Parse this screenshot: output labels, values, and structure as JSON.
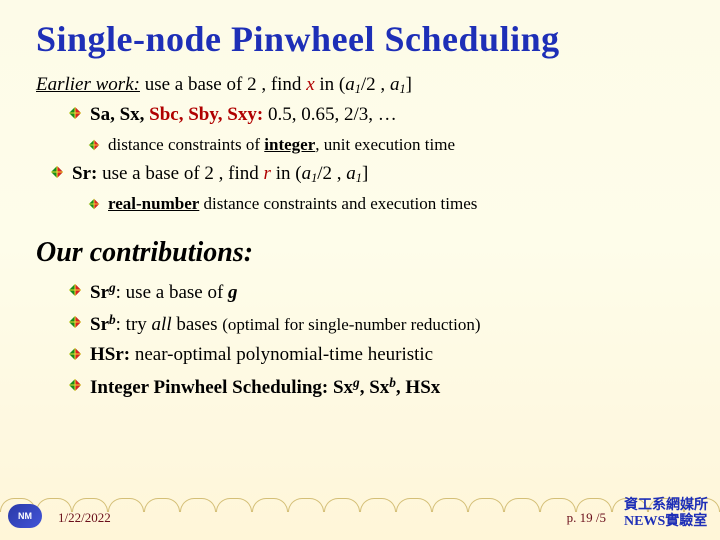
{
  "title": "Single-node Pinwheel Scheduling",
  "earlier": {
    "label": "Earlier work:",
    "rest_a": " use a base of 2 , find ",
    "x": "x",
    "rest_b": " in (",
    "a1": "a",
    "sub1": "1",
    "rest_c": "/2 , ",
    "a2": "a",
    "sub2": "1",
    "close": "]"
  },
  "line_sa": {
    "lead": "Sa, Sx, ",
    "red": "Sbc, Sby, Sxy:",
    "vals": " 0.5, 0.65, 2/3, …"
  },
  "line_dist_int": {
    "a": "distance constraints of ",
    "b": "integer",
    "c": ", unit execution time"
  },
  "line_sr": {
    "lead": "Sr:",
    "a": " use a base of 2 , find ",
    "r": "r",
    "b": " in (",
    "a1": "a",
    "s1": "1",
    "c": "/2 , ",
    "a2": "a",
    "s2": "1",
    "close": "]"
  },
  "line_real": {
    "a": "real-number",
    "b": " distance constraints and execution times"
  },
  "heading2": "Our contributions:",
  "contribs": {
    "c0": {
      "h": "Sr",
      "sup": "g",
      "a": ": use a base of ",
      "g": "g"
    },
    "c1": {
      "h": "Sr",
      "sup": "b",
      "a": ": try ",
      "all": "all",
      "b": " bases ",
      "paren": "(optimal for single-number reduction)"
    },
    "c2": {
      "h": "HSr:",
      "a": " near-optimal polynomial-time heuristic"
    },
    "c3": {
      "h": "Integer Pinwheel Scheduling: Sx",
      "g": "g",
      "sep": ", Sx",
      "b": "b",
      "tail": ", HSx"
    }
  },
  "footer": {
    "date": "1/22/2022",
    "page": "p. 19 /5",
    "lab1": "資工系網媒所",
    "lab2": "NEWS實驗室"
  }
}
